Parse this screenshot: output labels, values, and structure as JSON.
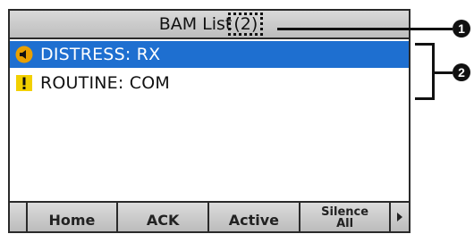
{
  "title_bar": {
    "title": "BAM List",
    "count": "(2)"
  },
  "alerts": [
    {
      "icon": "distress-speaker-icon",
      "label": "DISTRESS: RX",
      "selected": true
    },
    {
      "icon": "routine-exclamation-icon",
      "label": "ROUTINE: COM",
      "selected": false
    }
  ],
  "softkeys": {
    "home": "Home",
    "ack": "ACK",
    "active": "Active",
    "silence_line1": "Silence",
    "silence_line2": "All"
  },
  "callouts": {
    "one": "1",
    "two": "2"
  },
  "colors": {
    "selection": "#1e6fd0",
    "distress_icon": "#e8a000",
    "routine_icon": "#f2d000"
  }
}
